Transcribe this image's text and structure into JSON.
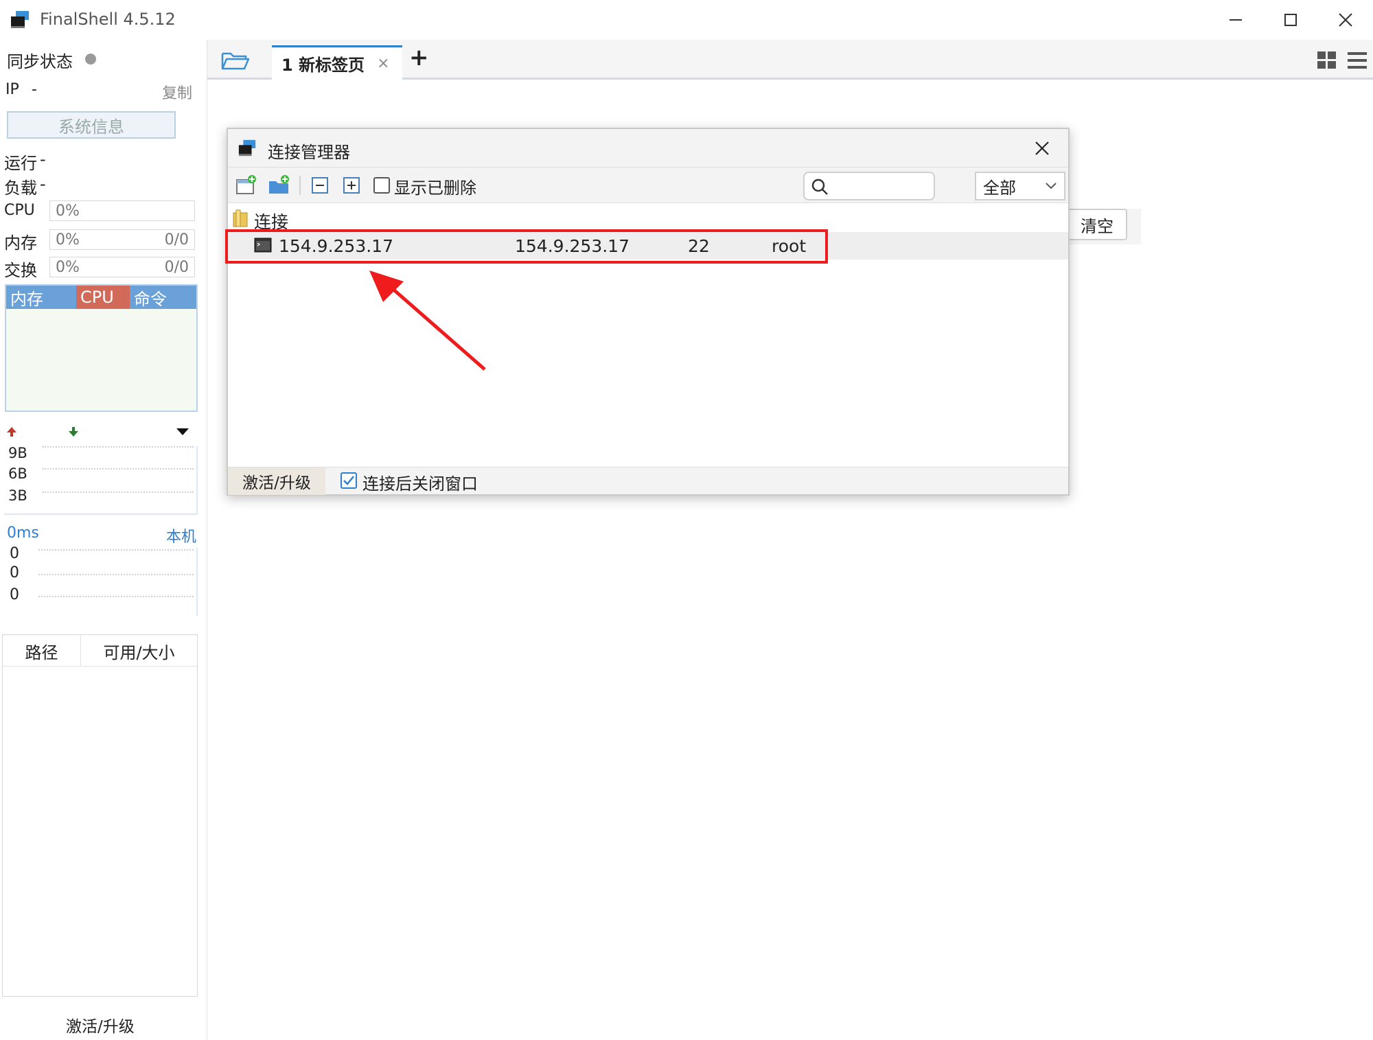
{
  "window": {
    "title": "FinalShell 4.5.12"
  },
  "sidebar": {
    "sync_status": "同步状态",
    "ip_label": "IP",
    "ip_value": "-",
    "copy": "复制",
    "sysinfo_button": "系统信息",
    "uptime_label": "运行",
    "uptime_value": "-",
    "load_label": "负载",
    "load_value": "-",
    "cpu_label": "CPU",
    "cpu_value": "0%",
    "mem_label": "内存",
    "mem_value": "0%",
    "mem_amount": "0/0",
    "swap_label": "交换",
    "swap_value": "0%",
    "swap_amount": "0/0",
    "monitor_tabs": [
      "内存",
      "CPU",
      "命令"
    ],
    "net_scale": [
      "9B",
      "6B",
      "3B"
    ],
    "latency": "0ms",
    "latency_target": "本机",
    "latency_scale": [
      "0",
      "0",
      "0"
    ],
    "disk_columns": [
      "路径",
      "可用/大小"
    ],
    "activate": "激活/升级"
  },
  "tabs": {
    "active_tab": "1 新标签页",
    "close": "×",
    "add": "+"
  },
  "dialog": {
    "title": "连接管理器",
    "show_deleted": "显示已删除",
    "search_placeholder": "",
    "filter_value": "全部",
    "folder": "连接",
    "connections": [
      {
        "name": "154.9.253.17",
        "host": "154.9.253.17",
        "port": "22",
        "user": "root"
      }
    ],
    "activate": "激活/升级",
    "close_after_connect": "连接后关闭窗口"
  },
  "background": {
    "clear_button": "清空"
  },
  "colors": {
    "accent": "#2f7fd0",
    "cpu_tab": "#d26a5a",
    "mem_tab": "#6aa1d8",
    "highlight": "#ee1c1c",
    "up_arrow": "#c0392b",
    "down_arrow": "#2e7d32"
  }
}
